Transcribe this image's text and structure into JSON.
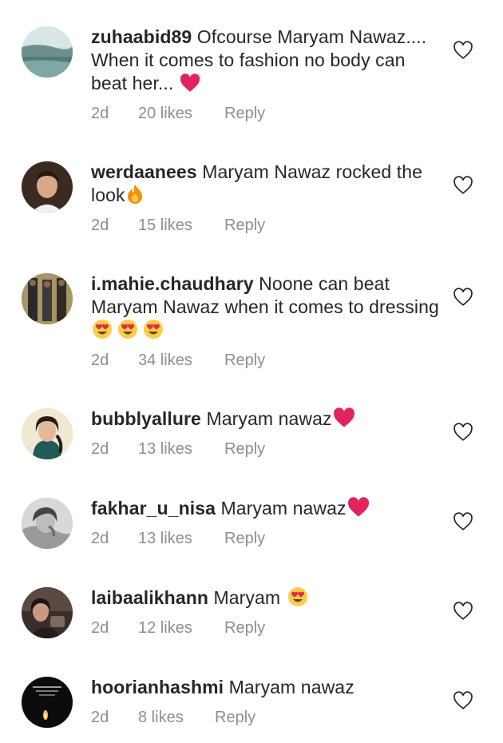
{
  "comments": [
    {
      "username": "zuhaabid89",
      "text": "Ofcourse Maryam Nawaz.... When it comes to fashion no body can beat her...",
      "time": "2d",
      "likes": "20 likes",
      "reply": "Reply"
    },
    {
      "username": "werdaanees",
      "text": "Maryam Nawaz rocked the look",
      "time": "2d",
      "likes": "15 likes",
      "reply": "Reply"
    },
    {
      "username": "i.mahie.chaudhary",
      "text": "Noone can beat Maryam Nawaz when it comes to dressing",
      "time": "2d",
      "likes": "34 likes",
      "reply": "Reply"
    },
    {
      "username": "bubblyallure",
      "text": "Maryam nawaz",
      "time": "2d",
      "likes": "13 likes",
      "reply": "Reply"
    },
    {
      "username": "fakhar_u_nisa",
      "text": "Maryam nawaz",
      "time": "2d",
      "likes": "13 likes",
      "reply": "Reply"
    },
    {
      "username": "laibaalikhann",
      "text": "Maryam",
      "time": "2d",
      "likes": "12 likes",
      "reply": "Reply"
    },
    {
      "username": "hoorianhashmi",
      "text": "Maryam nawaz",
      "time": "2d",
      "likes": "8 likes",
      "reply": "Reply"
    }
  ],
  "colors": {
    "text": "#262626",
    "meta": "#8e8e8e",
    "heart_red": "#e0245e"
  }
}
